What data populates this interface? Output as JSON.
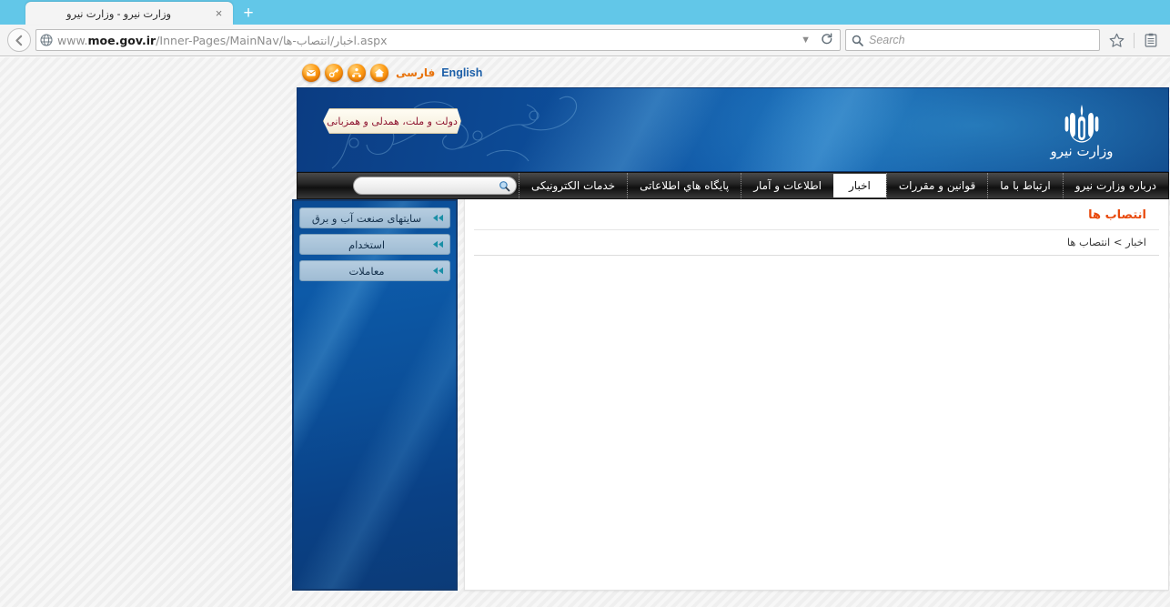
{
  "browser": {
    "tab_title": "وزارت نیرو - وزارت نیرو",
    "close_glyph": "×",
    "newtab_glyph": "+",
    "url_prefix": "www.",
    "url_domain": "moe.gov.ir",
    "url_path": "/Inner-Pages/MainNav/اخبار/انتصاب-ها.aspx",
    "dropdown_glyph": "▼",
    "reload_glyph": "⟳",
    "search_placeholder": "Search",
    "search_value": "",
    "bookmark_glyph": "☆",
    "readinglist_glyph": "▤"
  },
  "site": {
    "toplinks": {
      "icons": [
        {
          "name": "email-icon",
          "glyph": "✉"
        },
        {
          "name": "login-key-icon",
          "glyph": "✎"
        },
        {
          "name": "sitemap-icon",
          "glyph": "⚇"
        },
        {
          "name": "home-icon",
          "glyph": "⌂"
        }
      ],
      "persian_label": "فارسی",
      "english_label": "English"
    },
    "banner": {
      "calligraphy_text": "دولت و ملت، همدلی و همزبانی",
      "ministry_name": "وزارت نیرو",
      "emblem_glyph": "﷼"
    },
    "nav": {
      "items": [
        {
          "label": "درباره وزارت نیرو",
          "active": false
        },
        {
          "label": "ارتباط با ما",
          "active": false
        },
        {
          "label": "قوانین و مقررات",
          "active": false
        },
        {
          "label": "اخبار",
          "active": true
        },
        {
          "label": "اطلاعات و آمار",
          "active": false
        },
        {
          "label": "پایگاه هاي اطلاعاتی",
          "active": false
        },
        {
          "label": "خدمات الکترونیکی",
          "active": false
        }
      ],
      "search_placeholder": "",
      "search_value": "",
      "search_icon": "search-icon"
    },
    "content": {
      "page_title": "انتصاب ها",
      "breadcrumb": "اخبار > انتصاب ها",
      "body_text": ""
    },
    "sidebar": {
      "buttons": [
        {
          "label": "سایتهای صنعت آب و برق",
          "icon": "arrow-left-icon"
        },
        {
          "label": "استخدام",
          "icon": "arrow-left-icon"
        },
        {
          "label": "معاملات",
          "icon": "arrow-left-icon"
        }
      ]
    }
  },
  "colors": {
    "accent_orange": "#e8490c",
    "brand_blue": "#0d4f9c",
    "tabstrip_blue": "#62c7e8",
    "sidebar_btn": "#aac4da",
    "english_link": "#1c5fa8",
    "persian_link": "#e8730c"
  }
}
